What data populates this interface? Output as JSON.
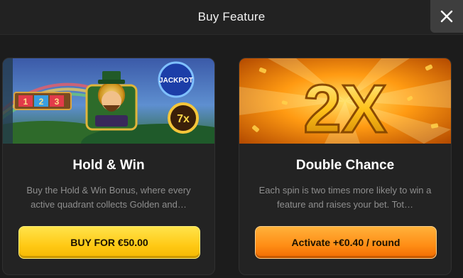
{
  "header": {
    "title": "Buy Feature"
  },
  "colors": {
    "yellow": "#ffc915",
    "orange": "#ff8d15",
    "gold": "#f5b800"
  },
  "features": [
    {
      "banner": {
        "jackpot_label": "JACKPOT",
        "multiplier_label": "7x",
        "reels": [
          "1",
          "2",
          "3"
        ]
      },
      "title": "Hold & Win",
      "description": "Buy the Hold & Win Bonus, where every active quadrant collects Golden and…",
      "button_label": "BUY FOR €50.00"
    },
    {
      "banner": {
        "big_label": "2X"
      },
      "title": "Double Chance",
      "description": "Each spin is two times more likely to win a feature and raises your bet. Tot…",
      "button_label": "Activate +€0.40 / round"
    }
  ]
}
